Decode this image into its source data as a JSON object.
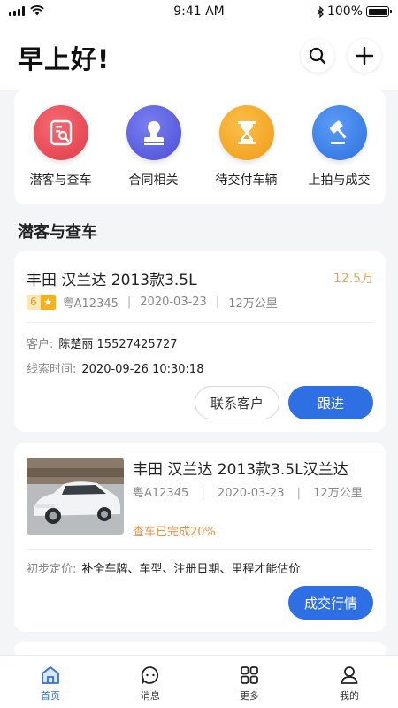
{
  "status_bar": {
    "time": "9:41 AM",
    "battery": "100%"
  },
  "header": {
    "greeting": "早上好!"
  },
  "quick_menu": [
    {
      "label": "潜客与查车",
      "icon": "customer-check-icon",
      "color": "#e84c57"
    },
    {
      "label": "合同相关",
      "icon": "contract-stamp-icon",
      "color": "#5b5fe0"
    },
    {
      "label": "待交付车辆",
      "icon": "hourglass-icon",
      "color": "#f5a623"
    },
    {
      "label": "上拍与成交",
      "icon": "auction-hammer-icon",
      "color": "#3b82f0"
    }
  ],
  "section": {
    "title": "潜客与查车"
  },
  "lead_card": {
    "title": "丰田  汉兰达  2013款3.5L",
    "price": "12.5万",
    "rating": "6",
    "plate": "粤A12345",
    "date": "2020-03-23",
    "mileage": "12万公里",
    "customer_label": "客户:",
    "customer_value": "陈楚丽 15527425727",
    "time_label": "线索时间:",
    "time_value": "2020-09-26 10:30:18",
    "contact_button": "联系客户",
    "follow_button": "跟进"
  },
  "inspect_card": {
    "title": "丰田  汉兰达  2013款3.5L汉兰达",
    "plate": "粤A12345",
    "date": "2020-03-23",
    "mileage": "12万公里",
    "status": "查车已完成20%",
    "price_label": "初步定价:",
    "price_value": "补全车牌、车型、注册日期、里程才能估价",
    "market_button": "成交行情"
  },
  "tab_bar": [
    {
      "label": "首页",
      "icon": "home-icon",
      "active": true
    },
    {
      "label": "消息",
      "icon": "message-icon",
      "active": false
    },
    {
      "label": "更多",
      "icon": "grid-icon",
      "active": false
    },
    {
      "label": "我的",
      "icon": "profile-icon",
      "active": false
    }
  ],
  "colors": {
    "accent": "#2f6fe4",
    "price": "#f0a35a",
    "status": "#f0914a",
    "background": "#f4f5f7"
  }
}
